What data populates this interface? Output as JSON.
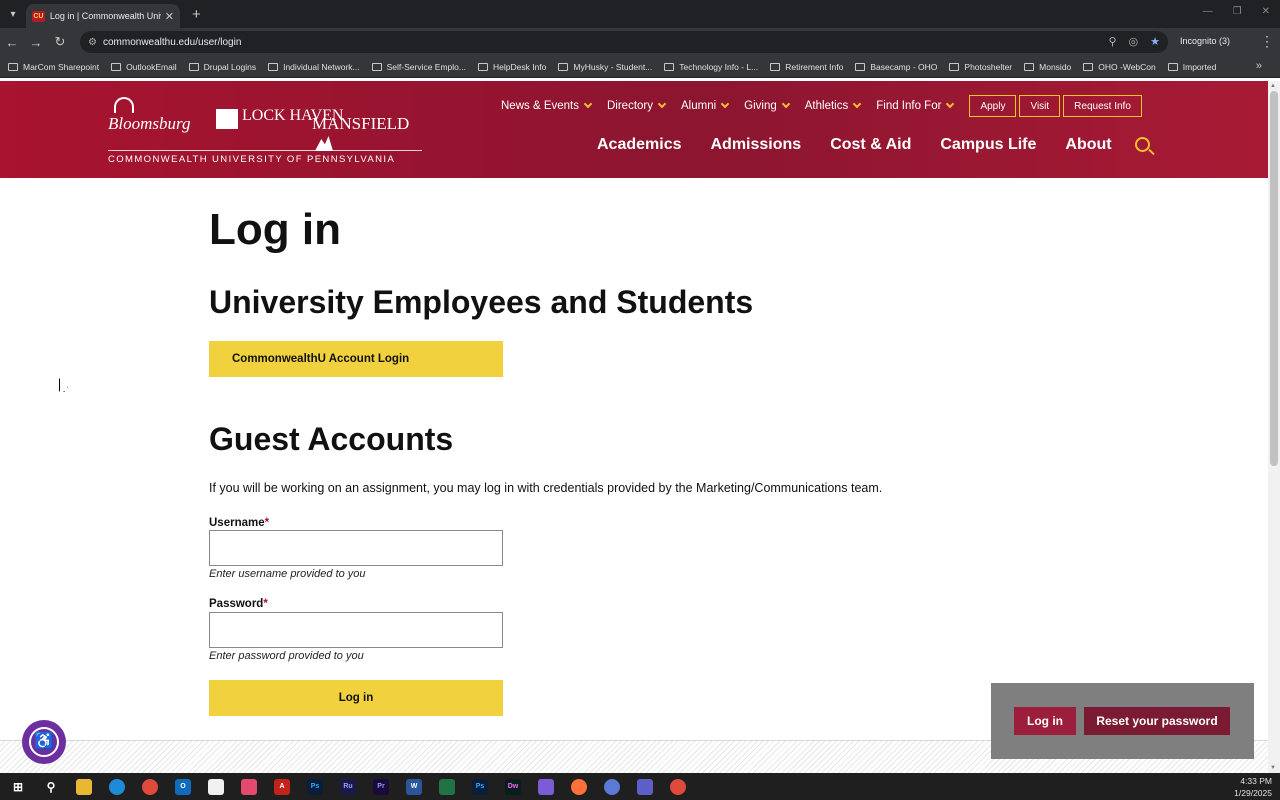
{
  "browser": {
    "tab_title": "Log in | Commonwealth Univers",
    "tab_favicon": "CU",
    "url": "commonwealthu.edu/user/login",
    "incognito_label": "Incognito (3)",
    "bookmarks": [
      "MarCom Sharepoint",
      "OutlookEmail",
      "Drupal Logins",
      "Individual Network...",
      "Self-Service Emplo...",
      "HelpDesk Info",
      "MyHusky - Student...",
      "Technology Info - L...",
      "Retirement Info",
      "Basecamp - OHO",
      "Photoshelter",
      "Monsido",
      "OHO -WebCon",
      "Imported"
    ]
  },
  "header": {
    "logo_bloomsburg": "Bloomsburg",
    "logo_lockhaven": "LOCK HAVEN",
    "logo_mansfield": "MANSFIELD",
    "logo_sub": "COMMONWEALTH UNIVERSITY OF PENNSYLVANIA",
    "util_nav": [
      "News & Events",
      "Directory",
      "Alumni",
      "Giving",
      "Athletics",
      "Find Info For"
    ],
    "util_buttons": [
      "Apply",
      "Visit",
      "Request Info"
    ],
    "main_nav": [
      "Academics",
      "Admissions",
      "Cost & Aid",
      "Campus Life",
      "About"
    ]
  },
  "page": {
    "title": "Log in",
    "section1_title": "University Employees and Students",
    "sso_button": "CommonwealthU Account Login",
    "section2_title": "Guest Accounts",
    "intro": "If you will be working on an assignment, you may log in with credentials provided by the Marketing/Communications team.",
    "username_label": "Username",
    "username_value": "",
    "username_help": "Enter username provided to you",
    "password_label": "Password",
    "password_value": "",
    "password_help": "Enter password provided to you",
    "required_mark": "*",
    "login_button": "Log in"
  },
  "panel": {
    "login": "Log in",
    "reset": "Reset your password"
  },
  "taskbar": {
    "time": "4:33 PM",
    "date": "1/29/2025"
  },
  "colors": {
    "brand_red": "#a8132f",
    "brand_yellow": "#f1d13d",
    "accessibility_purple": "#6d2ea0"
  }
}
